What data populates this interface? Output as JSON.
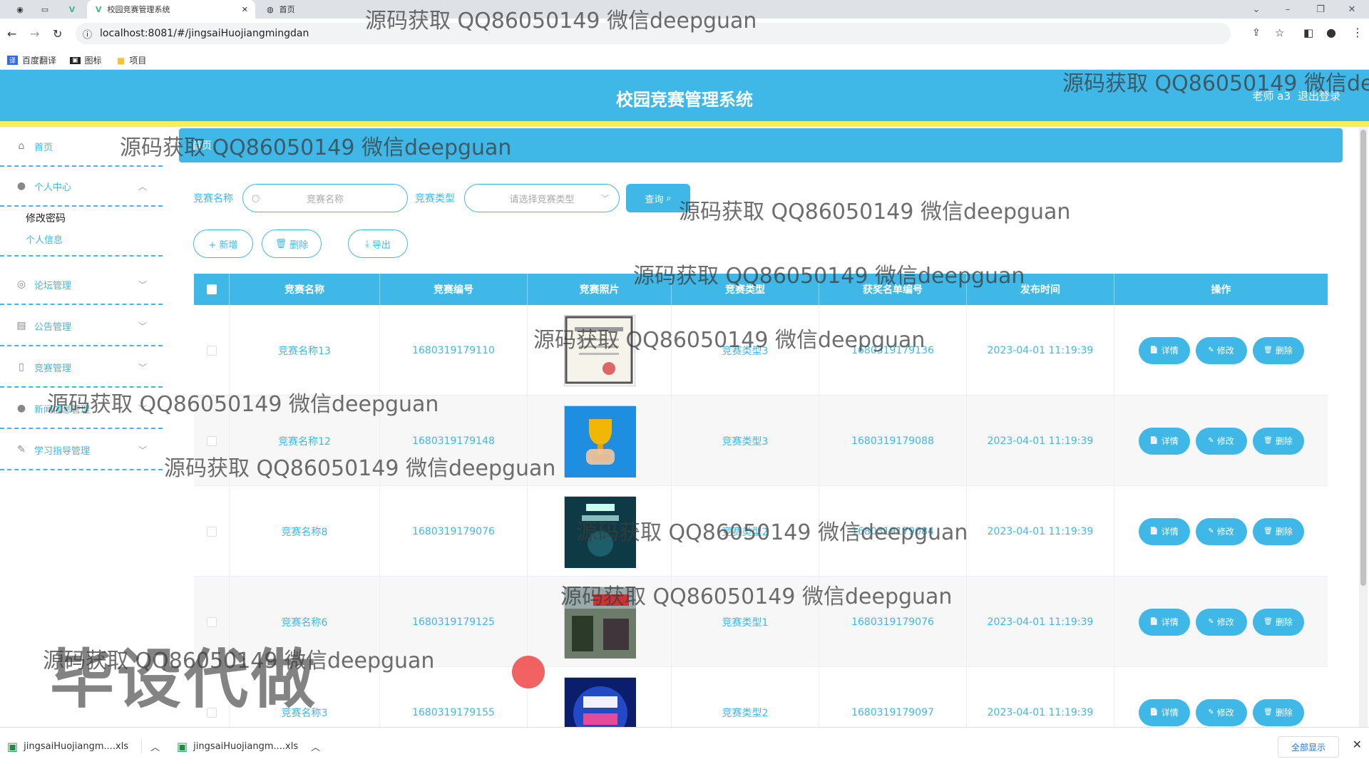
{
  "browser": {
    "tabs": [
      {
        "label": "校园竞赛管理系统",
        "icon": "vue-icon",
        "active": true
      },
      {
        "label": "首页",
        "icon": "globe-icon",
        "active": false
      }
    ],
    "url": "localhost:8081/#/jingsaiHuojiangmingdan",
    "bookmarks": [
      {
        "label": "百度翻译",
        "icon": "translate-icon"
      },
      {
        "label": "图标",
        "icon": "bookmark-icon"
      },
      {
        "label": "项目",
        "icon": "folder-icon"
      }
    ]
  },
  "header": {
    "title": "校园竞赛管理系统",
    "user": "老师 a3",
    "logout": "退出登录"
  },
  "sidebar": {
    "items": [
      {
        "label": "首页",
        "icon": "home-icon"
      },
      {
        "label": "个人中心",
        "icon": "user-icon",
        "expanded": true,
        "children": [
          {
            "label": "修改密码"
          },
          {
            "label": "个人信息"
          }
        ]
      },
      {
        "label": "论坛管理",
        "icon": "forum-icon"
      },
      {
        "label": "公告管理",
        "icon": "notice-icon"
      },
      {
        "label": "竞赛管理",
        "icon": "competition-icon"
      },
      {
        "label": "新闻信息管理",
        "icon": "news-icon"
      },
      {
        "label": "学习指导管理",
        "icon": "guide-icon"
      }
    ]
  },
  "breadcrumb": "首页",
  "filters": {
    "name_label": "竞赛名称",
    "name_placeholder": "竞赛名称",
    "type_label": "竞赛类型",
    "type_placeholder": "请选择竞赛类型",
    "query_button": "查询"
  },
  "actions": {
    "add": "+ 新增",
    "delete": "删除",
    "export": "导出"
  },
  "table": {
    "columns": [
      "竞赛名称",
      "竞赛编号",
      "竞赛照片",
      "竞赛类型",
      "获奖名单编号",
      "发布时间",
      "操作"
    ],
    "rows": [
      {
        "name": "竞赛名称13",
        "code": "1680319179110",
        "type": "竞赛类型3",
        "list_no": "1680319179136",
        "time": "2023-04-01 11:19:39",
        "photo": "certificate"
      },
      {
        "name": "竞赛名称12",
        "code": "1680319179148",
        "type": "竞赛类型3",
        "list_no": "1680319179088",
        "time": "2023-04-01 11:19:39",
        "photo": "trophy"
      },
      {
        "name": "竞赛名称8",
        "code": "1680319179076",
        "type": "竞赛类型2",
        "list_no": "1680319179084",
        "time": "2023-04-01 11:19:39",
        "photo": "poster"
      },
      {
        "name": "竞赛名称6",
        "code": "1680319179125",
        "type": "竞赛类型1",
        "list_no": "1680319179076",
        "time": "2023-04-01 11:19:39",
        "photo": "event"
      },
      {
        "name": "竞赛名称3",
        "code": "1680319179155",
        "type": "竞赛类型2",
        "list_no": "1680319179097",
        "time": "2023-04-01 11:19:39",
        "photo": "quiz"
      }
    ],
    "op_labels": {
      "detail": "详情",
      "edit": "修改",
      "remove": "删除"
    }
  },
  "downloads": {
    "files": [
      "jingsaiHuojiangm....xls",
      "jingsaiHuojiangm....xls"
    ],
    "show_all": "全部显示"
  },
  "watermarks": {
    "text": "源码获取 QQ86050149 微信deepguan",
    "text_cut": "源码获取 QQ86050149 微信de",
    "big": "毕设代做"
  },
  "colors": {
    "primary": "#3fb8e7",
    "accent_bar": "#f5ef55"
  }
}
